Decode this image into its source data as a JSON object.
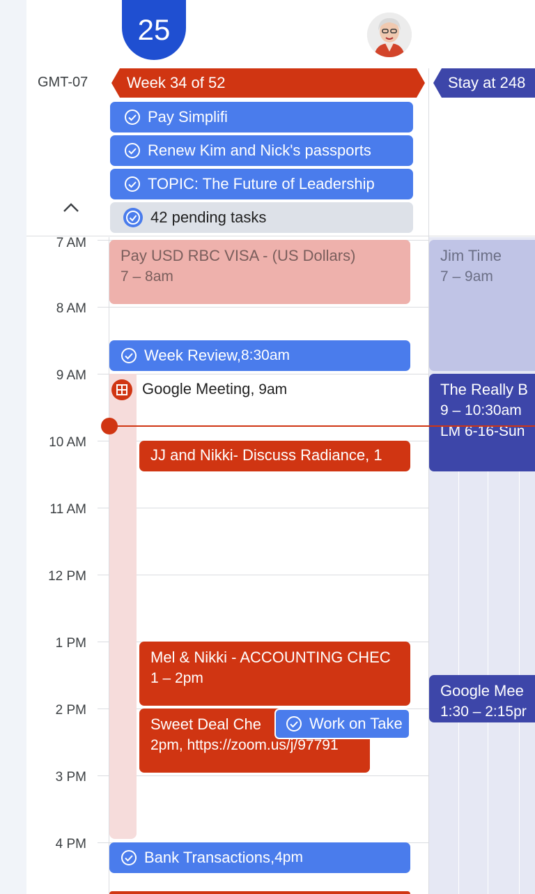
{
  "day": {
    "date_number": "25"
  },
  "timezone": "GMT-07",
  "banners": {
    "week": "Week 34 of 52",
    "stay": "Stay at 248"
  },
  "all_day_tasks": [
    "Pay Simplifi",
    "Renew Kim and Nick's passports",
    "TOPIC: The Future of Leadership"
  ],
  "pending": "42 pending tasks",
  "hours": [
    "7 AM",
    "8 AM",
    "9 AM",
    "10 AM",
    "11 AM",
    "12 PM",
    "1 PM",
    "2 PM",
    "3 PM",
    "4 PM"
  ],
  "events": {
    "pay_visa": {
      "title": "Pay USD RBC VISA - (US Dollars)",
      "time": "7 – 8am"
    },
    "week_review": {
      "title": "Week Review,",
      "time": " 8:30am"
    },
    "google_meeting": {
      "title": "Google Meeting,",
      "time": " 9am"
    },
    "jj_nikki": {
      "title": "JJ and Nikki- Discuss Radiance, 1"
    },
    "mel_nikki": {
      "title": "Mel & Nikki - ACCOUNTING CHEC",
      "time": "1 – 2pm"
    },
    "sweet_deal": {
      "title": "Sweet Deal Che",
      "time": "2pm, https://zoom.us/j/97791"
    },
    "work_on": {
      "title": "Work on Take"
    },
    "bank": {
      "title": "Bank Transactions,",
      "time": " 4pm"
    },
    "jim_time": {
      "title": "Jim Time",
      "time": "7 – 9am"
    },
    "really": {
      "title": "The Really B",
      "time": "9 – 10:30am",
      "extra": "LM 6-16-Sun"
    },
    "google_mee2": {
      "title": "Google Mee",
      "time": "1:30 – 2:15pr"
    }
  },
  "colors": {
    "tomato": "#d03512",
    "blueberry": "#4a7cec",
    "flamingo": "#eeb1ac",
    "indigo": "#3d46a9",
    "lavender": "#c0c4e6",
    "today": "#1f4fd1"
  },
  "icons": {
    "task": "check-circle-icon",
    "collapse": "chevron-up-icon",
    "meeting": "grid-calendar-icon"
  }
}
